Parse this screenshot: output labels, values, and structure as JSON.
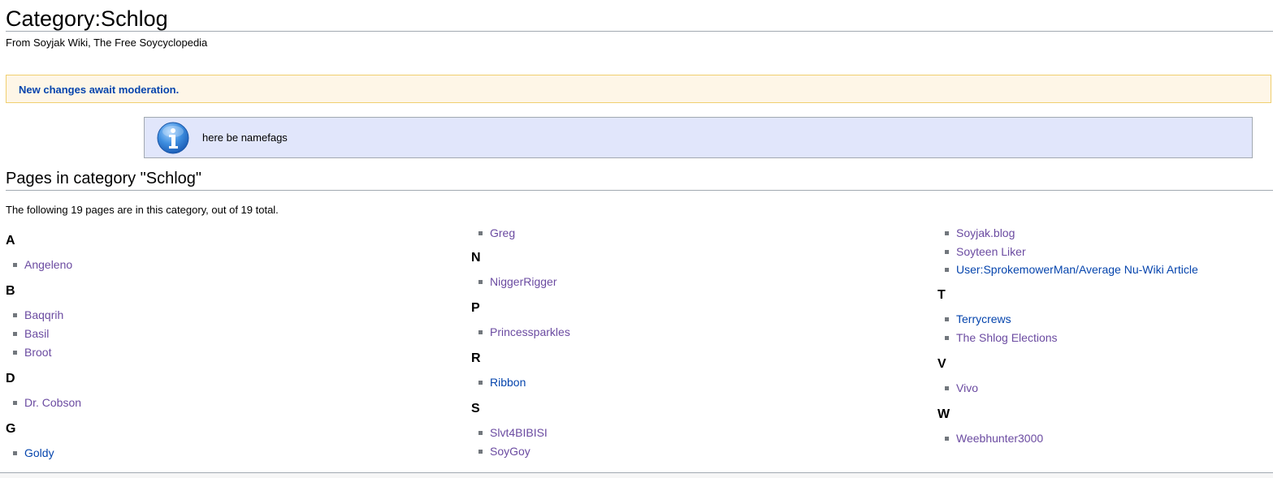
{
  "page": {
    "title": "Category:Schlog",
    "subtitle": "From Soyjak Wiki, The Free Soycyclopedia"
  },
  "moderation": {
    "text": "New changes await moderation."
  },
  "notice": {
    "icon": "info-icon",
    "text": "here be namefags"
  },
  "category": {
    "heading": "Pages in category \"Schlog\"",
    "count_text": "The following 19 pages are in this category, out of 19 total."
  },
  "groups": [
    {
      "letter": "A",
      "items": [
        {
          "label": "Angeleno",
          "visited": true
        }
      ]
    },
    {
      "letter": "B",
      "items": [
        {
          "label": "Baqqrih",
          "visited": true
        },
        {
          "label": "Basil",
          "visited": true
        },
        {
          "label": "Broot",
          "visited": true
        }
      ]
    },
    {
      "letter": "D",
      "items": [
        {
          "label": "Dr. Cobson",
          "visited": true
        }
      ]
    },
    {
      "letter": "G",
      "items": [
        {
          "label": "Goldy",
          "visited": false
        },
        {
          "label": "Greg",
          "visited": true
        }
      ]
    },
    {
      "letter": "N",
      "items": [
        {
          "label": "NiggerRigger",
          "visited": true
        }
      ]
    },
    {
      "letter": "P",
      "items": [
        {
          "label": "Princessparkles",
          "visited": true
        }
      ]
    },
    {
      "letter": "R",
      "items": [
        {
          "label": "Ribbon",
          "visited": false
        }
      ]
    },
    {
      "letter": "S",
      "items": [
        {
          "label": "Slvt4BIBISI",
          "visited": true
        },
        {
          "label": "SoyGoy",
          "visited": true
        },
        {
          "label": "Soyjak.blog",
          "visited": true
        },
        {
          "label": "Soyteen Liker",
          "visited": true
        },
        {
          "label": "User:SprokemowerMan/Average Nu-Wiki Article",
          "visited": false
        }
      ]
    },
    {
      "letter": "T",
      "items": [
        {
          "label": "Terrycrews",
          "visited": false
        },
        {
          "label": "The Shlog Elections",
          "visited": true
        }
      ]
    },
    {
      "letter": "V",
      "items": [
        {
          "label": "Vivo",
          "visited": true
        }
      ]
    },
    {
      "letter": "W",
      "items": [
        {
          "label": "Weebhunter3000",
          "visited": true
        }
      ]
    }
  ]
}
